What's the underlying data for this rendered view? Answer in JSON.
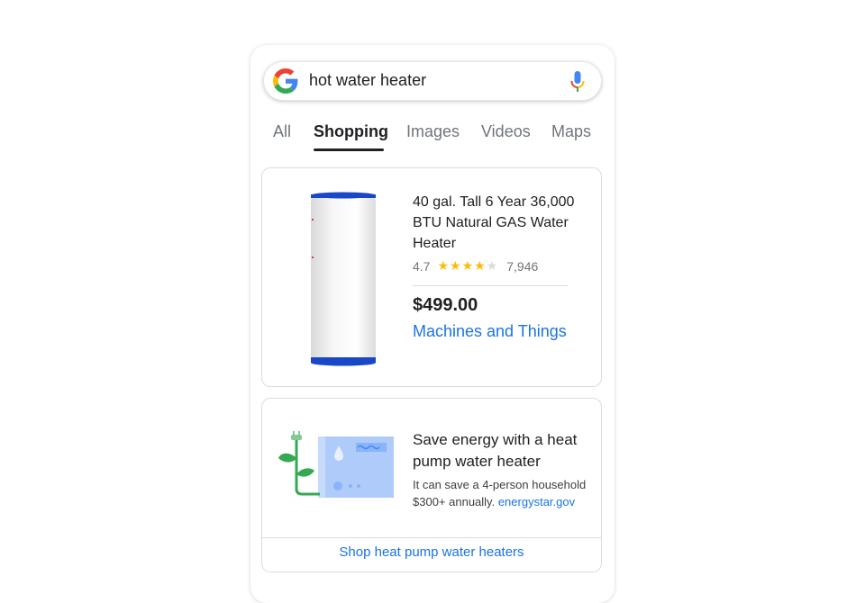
{
  "search": {
    "query": "hot water heater"
  },
  "tabs": [
    {
      "label": "All",
      "active": false
    },
    {
      "label": "Shopping",
      "active": true
    },
    {
      "label": "Images",
      "active": false
    },
    {
      "label": "Videos",
      "active": false
    },
    {
      "label": "Maps",
      "active": false
    }
  ],
  "product": {
    "title": "40 gal. Tall 6 Year 36,000 BTU Natural GAS Water Heater",
    "rating": "4.7",
    "stars_filled": 4,
    "stars_total": 5,
    "review_count": "7,946",
    "price": "$499.00",
    "seller": "Machines and Things"
  },
  "promo": {
    "title": "Save energy with a heat pump water heater",
    "body": "It can save a 4-person household $300+ annually.",
    "source_link": "energystar.gov",
    "cta": "Shop heat pump water heaters"
  },
  "colors": {
    "link_blue": "#1a73e8",
    "star_yellow": "#fbbc04",
    "heater_blue": "#1a47c8",
    "plant_green": "#34a853"
  }
}
